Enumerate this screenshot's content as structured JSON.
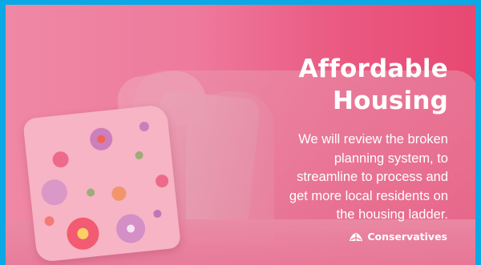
{
  "headline": {
    "line1": "Affordable",
    "line2": "Housing"
  },
  "body": {
    "lines": [
      "We will review the broken",
      "planning system, to",
      "streamline to process and",
      "get more local residents on",
      "the housing ladder."
    ]
  },
  "logo": {
    "text": "Conservatives",
    "icon": "tree-icon"
  },
  "colors": {
    "frame": "#0aa9e6",
    "background_left": "#ef88a5",
    "background_right": "#e84872",
    "text": "#ffffff"
  }
}
